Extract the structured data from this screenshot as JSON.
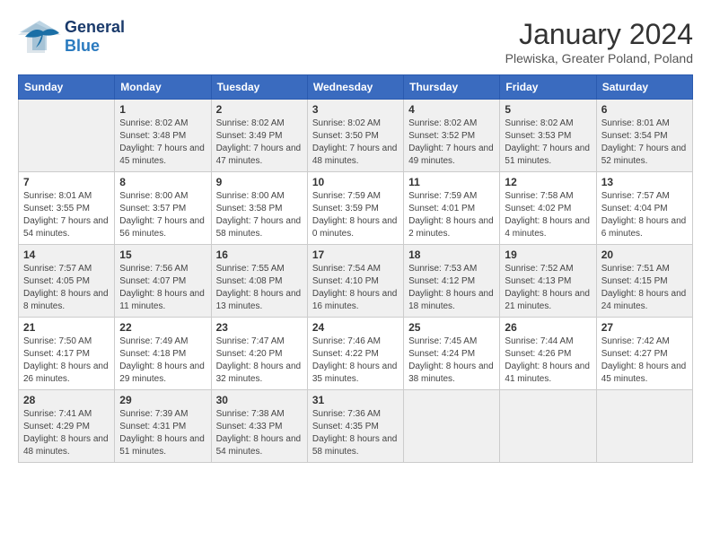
{
  "logo": {
    "text_general": "General",
    "text_blue": "Blue"
  },
  "title": "January 2024",
  "location": "Plewiska, Greater Poland, Poland",
  "days_of_week": [
    "Sunday",
    "Monday",
    "Tuesday",
    "Wednesday",
    "Thursday",
    "Friday",
    "Saturday"
  ],
  "weeks": [
    [
      {
        "day": null,
        "info": null
      },
      {
        "day": "1",
        "sunrise": "Sunrise: 8:02 AM",
        "sunset": "Sunset: 3:48 PM",
        "daylight": "Daylight: 7 hours and 45 minutes."
      },
      {
        "day": "2",
        "sunrise": "Sunrise: 8:02 AM",
        "sunset": "Sunset: 3:49 PM",
        "daylight": "Daylight: 7 hours and 47 minutes."
      },
      {
        "day": "3",
        "sunrise": "Sunrise: 8:02 AM",
        "sunset": "Sunset: 3:50 PM",
        "daylight": "Daylight: 7 hours and 48 minutes."
      },
      {
        "day": "4",
        "sunrise": "Sunrise: 8:02 AM",
        "sunset": "Sunset: 3:52 PM",
        "daylight": "Daylight: 7 hours and 49 minutes."
      },
      {
        "day": "5",
        "sunrise": "Sunrise: 8:02 AM",
        "sunset": "Sunset: 3:53 PM",
        "daylight": "Daylight: 7 hours and 51 minutes."
      },
      {
        "day": "6",
        "sunrise": "Sunrise: 8:01 AM",
        "sunset": "Sunset: 3:54 PM",
        "daylight": "Daylight: 7 hours and 52 minutes."
      }
    ],
    [
      {
        "day": "7",
        "sunrise": "Sunrise: 8:01 AM",
        "sunset": "Sunset: 3:55 PM",
        "daylight": "Daylight: 7 hours and 54 minutes."
      },
      {
        "day": "8",
        "sunrise": "Sunrise: 8:00 AM",
        "sunset": "Sunset: 3:57 PM",
        "daylight": "Daylight: 7 hours and 56 minutes."
      },
      {
        "day": "9",
        "sunrise": "Sunrise: 8:00 AM",
        "sunset": "Sunset: 3:58 PM",
        "daylight": "Daylight: 7 hours and 58 minutes."
      },
      {
        "day": "10",
        "sunrise": "Sunrise: 7:59 AM",
        "sunset": "Sunset: 3:59 PM",
        "daylight": "Daylight: 8 hours and 0 minutes."
      },
      {
        "day": "11",
        "sunrise": "Sunrise: 7:59 AM",
        "sunset": "Sunset: 4:01 PM",
        "daylight": "Daylight: 8 hours and 2 minutes."
      },
      {
        "day": "12",
        "sunrise": "Sunrise: 7:58 AM",
        "sunset": "Sunset: 4:02 PM",
        "daylight": "Daylight: 8 hours and 4 minutes."
      },
      {
        "day": "13",
        "sunrise": "Sunrise: 7:57 AM",
        "sunset": "Sunset: 4:04 PM",
        "daylight": "Daylight: 8 hours and 6 minutes."
      }
    ],
    [
      {
        "day": "14",
        "sunrise": "Sunrise: 7:57 AM",
        "sunset": "Sunset: 4:05 PM",
        "daylight": "Daylight: 8 hours and 8 minutes."
      },
      {
        "day": "15",
        "sunrise": "Sunrise: 7:56 AM",
        "sunset": "Sunset: 4:07 PM",
        "daylight": "Daylight: 8 hours and 11 minutes."
      },
      {
        "day": "16",
        "sunrise": "Sunrise: 7:55 AM",
        "sunset": "Sunset: 4:08 PM",
        "daylight": "Daylight: 8 hours and 13 minutes."
      },
      {
        "day": "17",
        "sunrise": "Sunrise: 7:54 AM",
        "sunset": "Sunset: 4:10 PM",
        "daylight": "Daylight: 8 hours and 16 minutes."
      },
      {
        "day": "18",
        "sunrise": "Sunrise: 7:53 AM",
        "sunset": "Sunset: 4:12 PM",
        "daylight": "Daylight: 8 hours and 18 minutes."
      },
      {
        "day": "19",
        "sunrise": "Sunrise: 7:52 AM",
        "sunset": "Sunset: 4:13 PM",
        "daylight": "Daylight: 8 hours and 21 minutes."
      },
      {
        "day": "20",
        "sunrise": "Sunrise: 7:51 AM",
        "sunset": "Sunset: 4:15 PM",
        "daylight": "Daylight: 8 hours and 24 minutes."
      }
    ],
    [
      {
        "day": "21",
        "sunrise": "Sunrise: 7:50 AM",
        "sunset": "Sunset: 4:17 PM",
        "daylight": "Daylight: 8 hours and 26 minutes."
      },
      {
        "day": "22",
        "sunrise": "Sunrise: 7:49 AM",
        "sunset": "Sunset: 4:18 PM",
        "daylight": "Daylight: 8 hours and 29 minutes."
      },
      {
        "day": "23",
        "sunrise": "Sunrise: 7:47 AM",
        "sunset": "Sunset: 4:20 PM",
        "daylight": "Daylight: 8 hours and 32 minutes."
      },
      {
        "day": "24",
        "sunrise": "Sunrise: 7:46 AM",
        "sunset": "Sunset: 4:22 PM",
        "daylight": "Daylight: 8 hours and 35 minutes."
      },
      {
        "day": "25",
        "sunrise": "Sunrise: 7:45 AM",
        "sunset": "Sunset: 4:24 PM",
        "daylight": "Daylight: 8 hours and 38 minutes."
      },
      {
        "day": "26",
        "sunrise": "Sunrise: 7:44 AM",
        "sunset": "Sunset: 4:26 PM",
        "daylight": "Daylight: 8 hours and 41 minutes."
      },
      {
        "day": "27",
        "sunrise": "Sunrise: 7:42 AM",
        "sunset": "Sunset: 4:27 PM",
        "daylight": "Daylight: 8 hours and 45 minutes."
      }
    ],
    [
      {
        "day": "28",
        "sunrise": "Sunrise: 7:41 AM",
        "sunset": "Sunset: 4:29 PM",
        "daylight": "Daylight: 8 hours and 48 minutes."
      },
      {
        "day": "29",
        "sunrise": "Sunrise: 7:39 AM",
        "sunset": "Sunset: 4:31 PM",
        "daylight": "Daylight: 8 hours and 51 minutes."
      },
      {
        "day": "30",
        "sunrise": "Sunrise: 7:38 AM",
        "sunset": "Sunset: 4:33 PM",
        "daylight": "Daylight: 8 hours and 54 minutes."
      },
      {
        "day": "31",
        "sunrise": "Sunrise: 7:36 AM",
        "sunset": "Sunset: 4:35 PM",
        "daylight": "Daylight: 8 hours and 58 minutes."
      },
      {
        "day": null,
        "info": null
      },
      {
        "day": null,
        "info": null
      },
      {
        "day": null,
        "info": null
      }
    ]
  ]
}
